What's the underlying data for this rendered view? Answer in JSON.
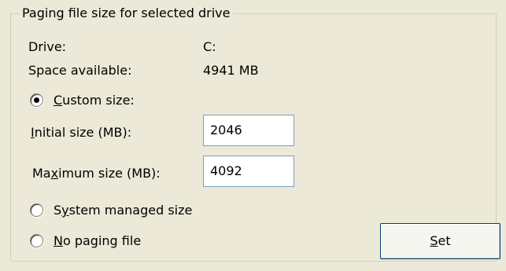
{
  "group": {
    "title": "Paging file size for selected drive"
  },
  "drive": {
    "label": "Drive:",
    "value": "C:"
  },
  "space": {
    "label": "Space available:",
    "value": "4941 MB"
  },
  "custom_size": {
    "mnemonic": "C",
    "rest": "ustom size:",
    "selected": true
  },
  "initial_size": {
    "mnemonic": "I",
    "rest": "nitial size (MB):",
    "value": "2046"
  },
  "maximum_size": {
    "pre": "Ma",
    "mnemonic": "x",
    "rest": "imum size (MB):",
    "value": "4092"
  },
  "system_managed": {
    "pre": "S",
    "mnemonic": "y",
    "rest": "stem managed size",
    "selected": false
  },
  "no_paging": {
    "mnemonic": "N",
    "rest": "o paging file",
    "selected": false
  },
  "set_button": {
    "mnemonic": "S",
    "rest": "et"
  }
}
